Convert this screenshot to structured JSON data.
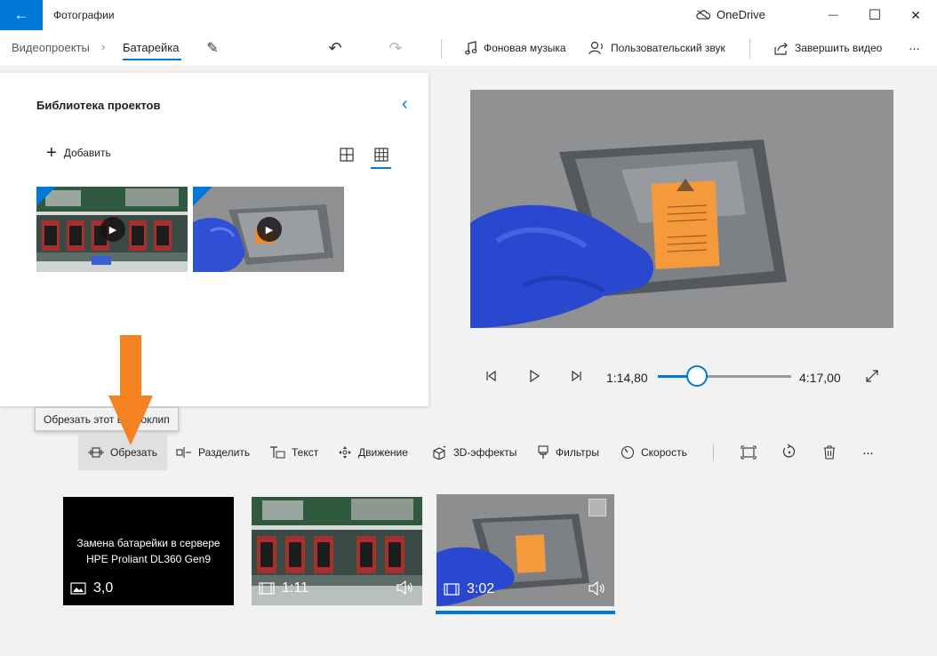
{
  "titlebar": {
    "app_title": "Фотографии",
    "onedrive_label": "OneDrive",
    "back_icon": "←",
    "minimize_icon": "—",
    "maximize_icon": "☐",
    "close_icon": "✕"
  },
  "cmdbar": {
    "breadcrumb_root": "Видеопроекты",
    "breadcrumb_sep": "›",
    "breadcrumb_current": "Батарейка",
    "music_label": "Фоновая музыка",
    "custom_audio_label": "Пользовательский звук",
    "finish_label": "Завершить видео",
    "more_icon": "···",
    "undo_icon": "↶",
    "redo_icon": "↷",
    "rename_icon": "✎"
  },
  "library": {
    "title": "Библиотека проектов",
    "add_label": "Добавить",
    "collapse_icon": "‹"
  },
  "player": {
    "current_time": "1:14,80",
    "total_time": "4:17,00",
    "progress": 0.29
  },
  "tooltip": {
    "text": "Обрезать этот видеоклип"
  },
  "storyboard_toolbar": {
    "trim_label": "Обрезать",
    "split_label": "Разделить",
    "text_label": "Текст",
    "motion_label": "Движение",
    "effects3d_label": "3D-эффекты",
    "filters_label": "Фильтры",
    "speed_label": "Скорость",
    "more_icon": "···"
  },
  "storyboard": {
    "cards": [
      {
        "title": "Замена батарейки в сервере HPE Proliant DL360 Gen9",
        "duration": "3,0"
      },
      {
        "duration": "1:11"
      },
      {
        "duration": "3:02"
      }
    ]
  },
  "colors": {
    "accent": "#0078d7",
    "annotation_arrow": "#f58220"
  }
}
